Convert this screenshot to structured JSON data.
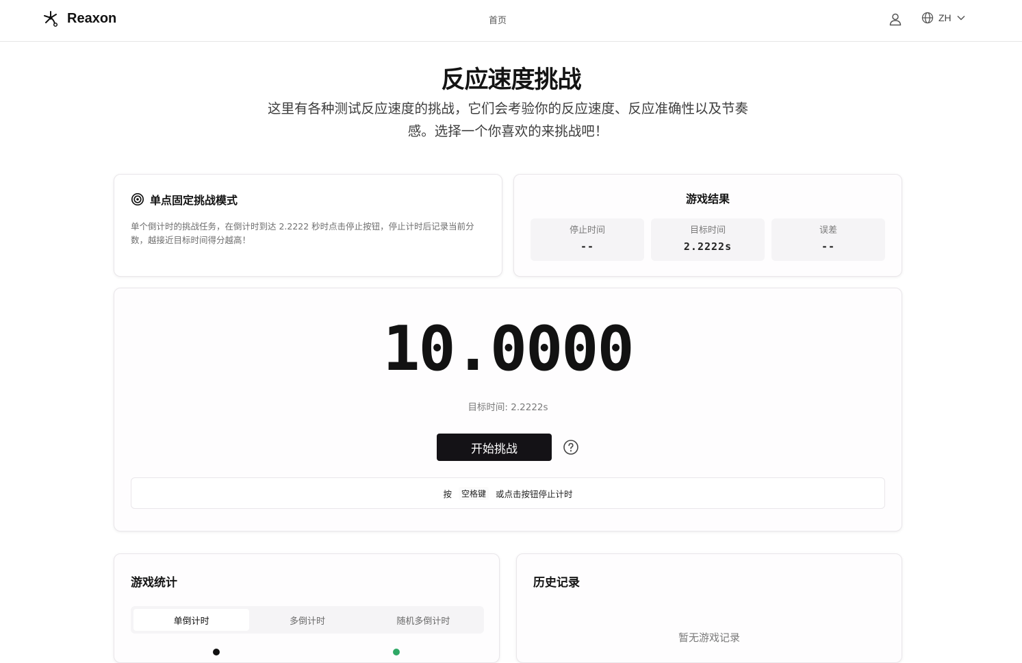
{
  "nav": {
    "brand": "Reaxon",
    "home": "首页",
    "lang": "ZH",
    "icons": {
      "logo": "neuron-logo-icon",
      "user": "user-icon",
      "globe": "globe-icon",
      "chevron": "chevron-down-icon"
    }
  },
  "hero": {
    "title": "反应速度挑战",
    "description": "这里有各种测试反应速度的挑战，它们会考验你的反应速度、反应准确性以及节奏感。选择一个你喜欢的来挑战吧！"
  },
  "mode": {
    "icon": "target-icon",
    "title": "单点固定挑战模式",
    "description": "单个倒计时的挑战任务，在倒计时到达 2.2222 秒时点击停止按钮，停止计时后记录当前分数，越接近目标时间得分越高！"
  },
  "result": {
    "title": "游戏结果",
    "cells": [
      {
        "label": "停止时间",
        "value": "--"
      },
      {
        "label": "目标时间",
        "value": "2.2222s"
      },
      {
        "label": "误差",
        "value": "--"
      }
    ]
  },
  "timer": {
    "display": "10.0000",
    "target_text": "目标时间: 2.2222s",
    "start_button": "开始挑战",
    "help_icon": "question-circle-icon",
    "hint_prefix": "按",
    "hint_key": "空格键",
    "hint_suffix": "或点击按钮停止计时"
  },
  "stats": {
    "title": "游戏统计",
    "tabs": [
      "单倒计时",
      "多倒计时",
      "随机多倒计时"
    ],
    "active_tab": 0
  },
  "history": {
    "title": "历史记录",
    "empty_text": "暂无游戏记录"
  },
  "colors": {
    "accent_button": "#141216",
    "chart_green": "#2fa866",
    "card_border": "#e9e6ea"
  }
}
